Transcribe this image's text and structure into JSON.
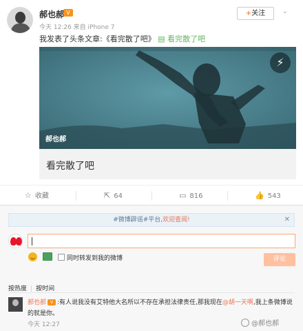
{
  "post": {
    "username": "郝也郝",
    "vip_badge": "V",
    "meta": "今天 12:26 来自 iPhone 7",
    "follow_label": "关注",
    "follow_plus": "+",
    "chevron": "⌄",
    "text_prefix": "我发表了头条文章:《看完散了吧》",
    "article_icon": "▤",
    "article_link": "看完散了吧",
    "card": {
      "watermark": "郝也郝",
      "title": "看完散了吧",
      "flash_icon": "⚡"
    }
  },
  "actions": {
    "favorite": {
      "icon": "☆",
      "label": "收藏"
    },
    "repost": {
      "icon": "⇱",
      "label": "64"
    },
    "comment": {
      "icon": "▭",
      "label": "816"
    },
    "like": {
      "icon": "👍",
      "label": "543"
    }
  },
  "comment_box": {
    "notice_prefix": "#微博辟谣#平台,",
    "notice_link": "欢迎查阅!",
    "notice_close": "✕",
    "repost_label": "同时转发到我的微博",
    "submit_label": "评论"
  },
  "comments": {
    "sort_hot": "按热度",
    "sort_time": "按时间",
    "items": [
      {
        "author": "郝也郝",
        "text_1": ":有人说我没有艾特他大名所以不存在承担法律责任,那我现在",
        "mention": "@胡一天啊",
        "text_2": ",我上条微博说的就是你。",
        "time": "今天 12:27",
        "logo_text": "@郝也郝"
      }
    ]
  }
}
